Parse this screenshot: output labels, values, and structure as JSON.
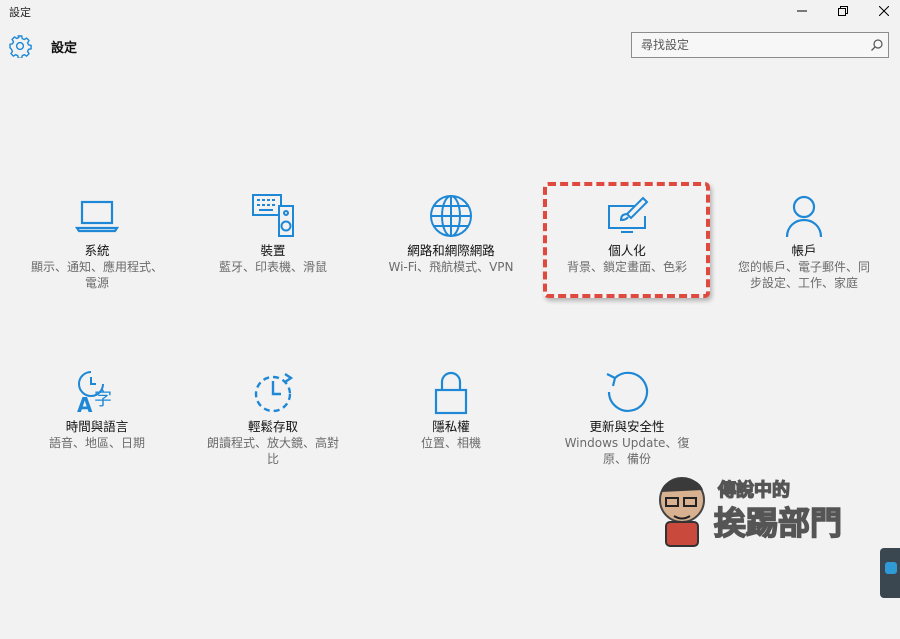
{
  "window": {
    "title": "設定"
  },
  "header": {
    "title": "設定"
  },
  "search": {
    "placeholder": "尋找設定"
  },
  "tiles": [
    {
      "name": "系統",
      "desc": "顯示、通知、應用程式、電源",
      "icon": "laptop-icon"
    },
    {
      "name": "裝置",
      "desc": "藍牙、印表機、滑鼠",
      "icon": "devices-icon"
    },
    {
      "name": "網路和網際網路",
      "desc": "Wi-Fi、飛航模式、VPN",
      "icon": "globe-icon"
    },
    {
      "name": "個人化",
      "desc": "背景、鎖定畫面、色彩",
      "icon": "paintbrush-icon"
    },
    {
      "name": "帳戶",
      "desc": "您的帳戶、電子郵件、同步設定、工作、家庭",
      "icon": "person-icon"
    },
    {
      "name": "時間與語言",
      "desc": "語音、地區、日期",
      "icon": "time-language-icon"
    },
    {
      "name": "輕鬆存取",
      "desc": "朗讀程式、放大鏡、高對比",
      "icon": "ease-of-access-icon"
    },
    {
      "name": "隱私權",
      "desc": "位置、相機",
      "icon": "lock-icon"
    },
    {
      "name": "更新與安全性",
      "desc": "Windows Update、復原、備份",
      "icon": "update-icon"
    }
  ],
  "watermark": {
    "line1": "傳說中的",
    "line2": "挨踢部門"
  },
  "colors": {
    "accent": "#1e88d6",
    "highlight": "#e0493e",
    "background": "#f2f2f2"
  }
}
